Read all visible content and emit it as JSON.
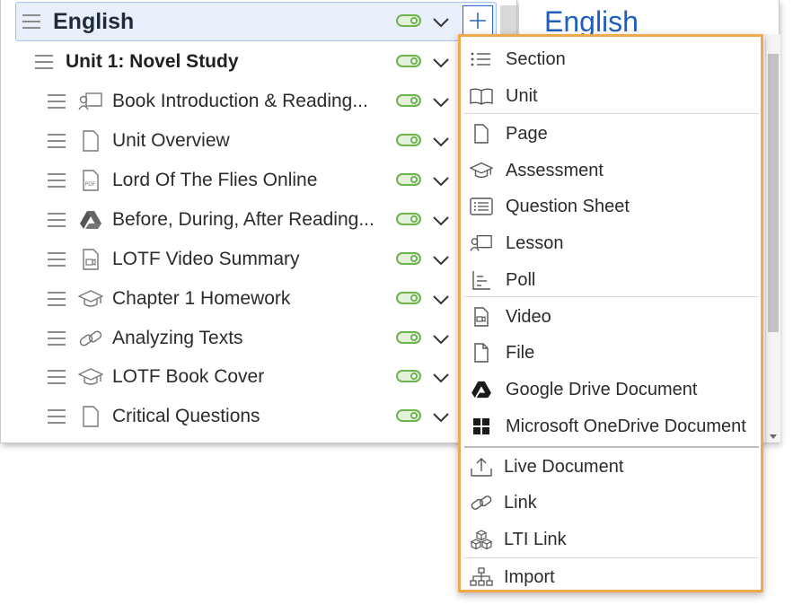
{
  "tree": {
    "course_title": "English",
    "unit_title": "Unit 1: Novel Study",
    "items": [
      {
        "label": "Book Introduction & Reading...",
        "icon": "lesson-icon"
      },
      {
        "label": "Unit Overview",
        "icon": "page-icon"
      },
      {
        "label": "Lord Of The Flies Online",
        "icon": "pdf-icon"
      },
      {
        "label": "Before, During, After Reading...",
        "icon": "google-drive-icon"
      },
      {
        "label": "LOTF Video Summary",
        "icon": "video-icon"
      },
      {
        "label": "Chapter 1 Homework",
        "icon": "assessment-icon"
      },
      {
        "label": "Analyzing Texts",
        "icon": "link-icon"
      },
      {
        "label": "LOTF Book Cover",
        "icon": "assessment-icon"
      },
      {
        "label": "Critical Questions",
        "icon": "page-icon"
      }
    ]
  },
  "right_panel": {
    "title": "English"
  },
  "menu": {
    "items": [
      {
        "label": "Section",
        "icon": "section-icon"
      },
      {
        "label": "Unit",
        "icon": "book-icon"
      },
      {
        "label": "Page",
        "icon": "page-icon"
      },
      {
        "label": "Assessment",
        "icon": "graduation-cap-icon"
      },
      {
        "label": "Question Sheet",
        "icon": "question-sheet-icon"
      },
      {
        "label": "Lesson",
        "icon": "lesson-icon"
      },
      {
        "label": "Poll",
        "icon": "poll-icon"
      },
      {
        "label": "Video",
        "icon": "video-icon"
      },
      {
        "label": "File",
        "icon": "file-icon"
      },
      {
        "label": "Google Drive Document",
        "icon": "google-drive-icon"
      },
      {
        "label": "Microsoft OneDrive Document",
        "icon": "windows-icon"
      },
      {
        "label": "Live Document",
        "icon": "upload-icon"
      },
      {
        "label": "Link",
        "icon": "link-icon"
      },
      {
        "label": "LTI Link",
        "icon": "cubes-icon"
      },
      {
        "label": "Import",
        "icon": "hierarchy-icon"
      }
    ]
  },
  "colors": {
    "accent": "#2e67c4",
    "toggle": "#6fb34e",
    "menu_border": "#f3a94a",
    "heading": "#1e5fbf"
  }
}
